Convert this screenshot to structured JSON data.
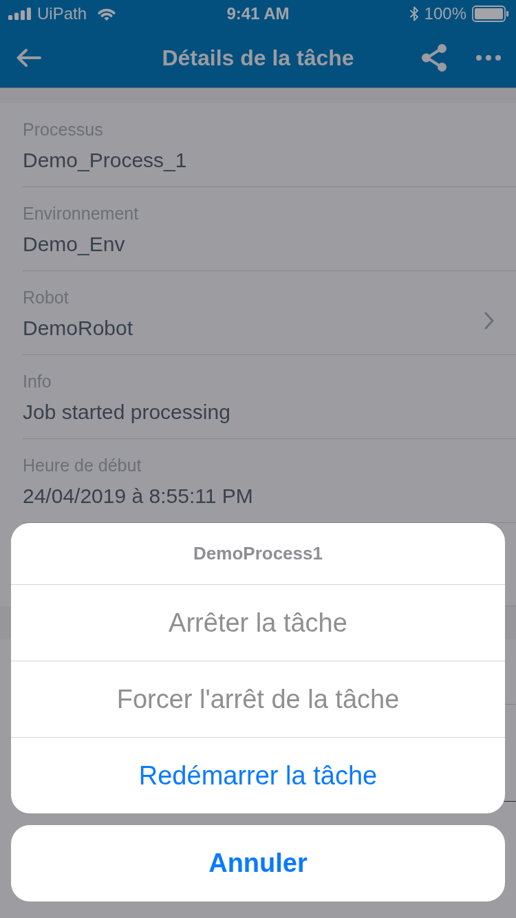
{
  "status_bar": {
    "carrier": "UiPath",
    "time": "9:41 AM",
    "battery": "100%"
  },
  "nav_bar": {
    "title": "Détails de la tâche"
  },
  "fields": [
    {
      "label": "Processus",
      "value": "Demo_Process_1",
      "chevron": false
    },
    {
      "label": "Environnement",
      "value": "Demo_Env",
      "chevron": false
    },
    {
      "label": "Robot",
      "value": "DemoRobot",
      "chevron": true
    },
    {
      "label": "Info",
      "value": "Job started processing",
      "chevron": false
    },
    {
      "label": "Heure de début",
      "value": "24/04/2019 à 8:55:11 PM",
      "chevron": false
    }
  ],
  "action_sheet": {
    "title": "DemoProcess1",
    "actions": [
      {
        "label": "Arrêter la tâche",
        "disabled": true
      },
      {
        "label": "Forcer l'arrêt de la tâche",
        "disabled": true
      },
      {
        "label": "Redémarrer la tâche",
        "disabled": false
      }
    ],
    "cancel": "Annuler"
  }
}
